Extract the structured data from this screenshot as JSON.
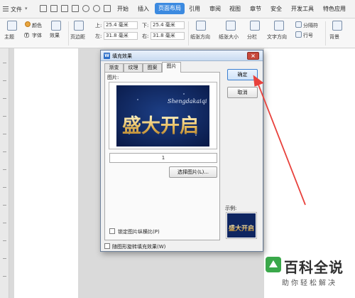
{
  "menubar": {
    "file_label": "文件",
    "tabs": [
      {
        "label": "开始"
      },
      {
        "label": "插入"
      },
      {
        "label": "页面布局",
        "active": true
      },
      {
        "label": "引用"
      },
      {
        "label": "审阅"
      },
      {
        "label": "视图"
      },
      {
        "label": "章节"
      },
      {
        "label": "安全"
      },
      {
        "label": "开发工具"
      },
      {
        "label": "特色应用"
      }
    ],
    "accent_color": "#3c8ae0"
  },
  "ribbon": {
    "theme_label": "主题",
    "color_label": "颜色",
    "font_label": "字体",
    "effect_label": "效果",
    "margins_label": "页边距",
    "top_label": "上:",
    "top_value": "25.4 毫米",
    "bottom_label": "下:",
    "bottom_value": "25.4 毫米",
    "left_label": "左:",
    "left_value": "31.8 毫米",
    "right_label": "右:",
    "right_value": "31.8 毫米",
    "orientation_label": "纸张方向",
    "size_label": "纸张大小",
    "columns_label": "分栏",
    "text_dir_label": "文字方向",
    "separator_label": "分隔符",
    "line_num_label": "行号",
    "background_label": "背景"
  },
  "dialog": {
    "title": "填充效果",
    "app_icon": "W",
    "tabs": [
      "渐变",
      "纹理",
      "图案",
      "图片"
    ],
    "selected_tab": "图片",
    "picture_label": "图片:",
    "picture_count": "1",
    "select_picture_button": "选择图片(L)...",
    "lock_ratio_label": "锁定图片纵横比(P)",
    "rotate_label": "随图形旋转填充效果(W)",
    "ok_button": "确定",
    "cancel_button": "取消",
    "sample_label": "示例:",
    "art_text_cn": "盛大开启",
    "art_text_en": "Shengdakaiqi"
  },
  "watermark": {
    "brand": "百科全说",
    "tagline": "助你轻松解决"
  }
}
